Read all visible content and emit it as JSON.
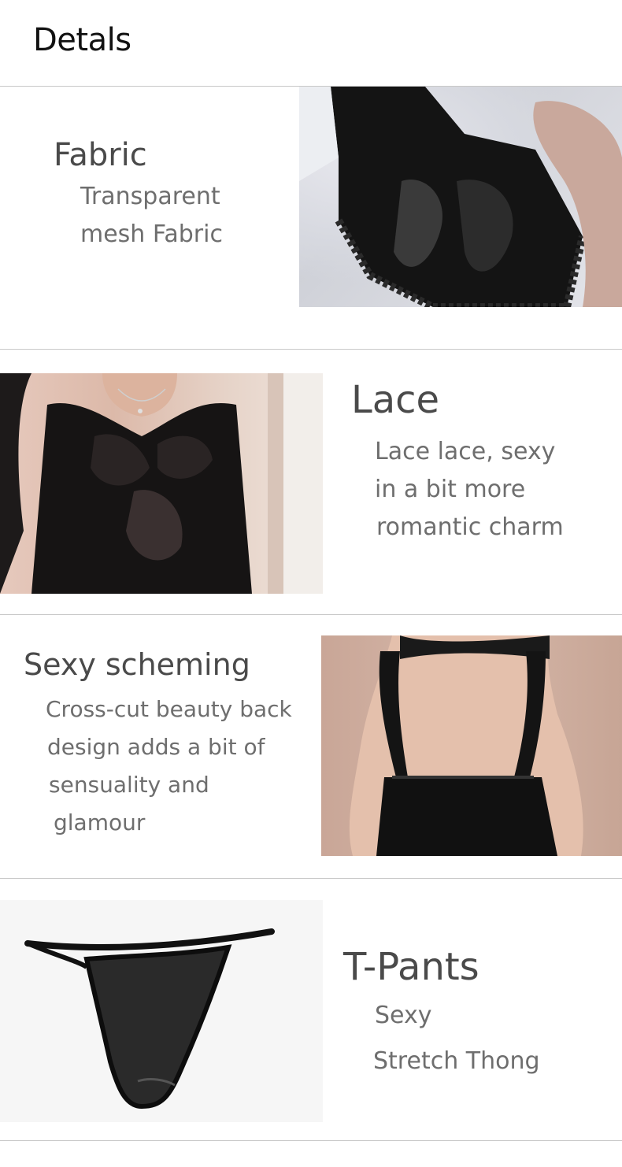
{
  "header": {
    "title": "Detals"
  },
  "sections": [
    {
      "title": "Fabric",
      "lines": [
        "Transparent",
        "mesh Fabric"
      ],
      "image": "lace-dress-hem-photo"
    },
    {
      "title": "Lace",
      "lines": [
        "Lace lace, sexy",
        "in a bit more",
        "romantic charm"
      ],
      "image": "lace-top-front-photo"
    },
    {
      "title": "Sexy scheming",
      "lines": [
        "Cross-cut beauty back",
        "design adds a bit of",
        "sensuality and",
        "glamour"
      ],
      "image": "open-back-photo"
    },
    {
      "title": "T-Pants",
      "lines": [
        "Sexy",
        "Stretch Thong"
      ],
      "image": "thong-photo"
    }
  ]
}
